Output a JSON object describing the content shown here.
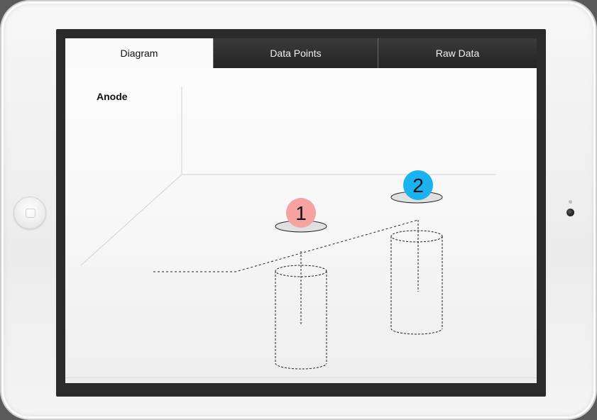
{
  "tabs": [
    {
      "label": "Diagram",
      "active": true
    },
    {
      "label": "Data Points",
      "active": false
    },
    {
      "label": "Raw Data",
      "active": false
    }
  ],
  "diagram": {
    "axis_label": "Anode",
    "points": [
      {
        "label": "1",
        "color": "#f4a3a0"
      },
      {
        "label": "2",
        "color": "#1ab2ef"
      }
    ]
  },
  "colors": {
    "tab_bar": "#2a2a2a",
    "bezel": "#2b2b2b",
    "point_1": "#f4a3a0",
    "point_2": "#1ab2ef"
  },
  "icons": {
    "home_button": "home-button-icon",
    "camera": "camera-icon"
  }
}
